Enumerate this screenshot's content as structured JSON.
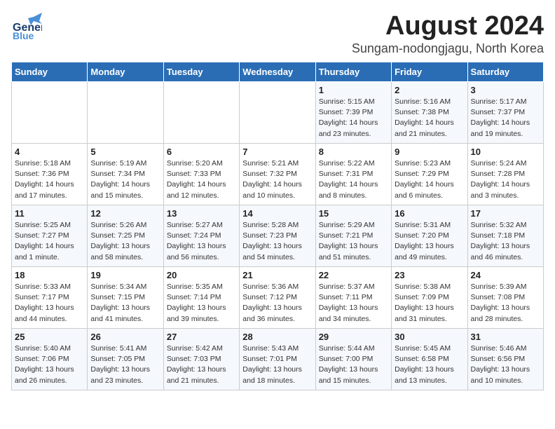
{
  "logo": {
    "text_general": "General",
    "text_blue": "Blue"
  },
  "title": "August 2024",
  "subtitle": "Sungam-nodongjagu, North Korea",
  "days_header": [
    "Sunday",
    "Monday",
    "Tuesday",
    "Wednesday",
    "Thursday",
    "Friday",
    "Saturday"
  ],
  "weeks": [
    [
      {
        "day": "",
        "info": ""
      },
      {
        "day": "",
        "info": ""
      },
      {
        "day": "",
        "info": ""
      },
      {
        "day": "",
        "info": ""
      },
      {
        "day": "1",
        "info": "Sunrise: 5:15 AM\nSunset: 7:39 PM\nDaylight: 14 hours\nand 23 minutes."
      },
      {
        "day": "2",
        "info": "Sunrise: 5:16 AM\nSunset: 7:38 PM\nDaylight: 14 hours\nand 21 minutes."
      },
      {
        "day": "3",
        "info": "Sunrise: 5:17 AM\nSunset: 7:37 PM\nDaylight: 14 hours\nand 19 minutes."
      }
    ],
    [
      {
        "day": "4",
        "info": "Sunrise: 5:18 AM\nSunset: 7:36 PM\nDaylight: 14 hours\nand 17 minutes."
      },
      {
        "day": "5",
        "info": "Sunrise: 5:19 AM\nSunset: 7:34 PM\nDaylight: 14 hours\nand 15 minutes."
      },
      {
        "day": "6",
        "info": "Sunrise: 5:20 AM\nSunset: 7:33 PM\nDaylight: 14 hours\nand 12 minutes."
      },
      {
        "day": "7",
        "info": "Sunrise: 5:21 AM\nSunset: 7:32 PM\nDaylight: 14 hours\nand 10 minutes."
      },
      {
        "day": "8",
        "info": "Sunrise: 5:22 AM\nSunset: 7:31 PM\nDaylight: 14 hours\nand 8 minutes."
      },
      {
        "day": "9",
        "info": "Sunrise: 5:23 AM\nSunset: 7:29 PM\nDaylight: 14 hours\nand 6 minutes."
      },
      {
        "day": "10",
        "info": "Sunrise: 5:24 AM\nSunset: 7:28 PM\nDaylight: 14 hours\nand 3 minutes."
      }
    ],
    [
      {
        "day": "11",
        "info": "Sunrise: 5:25 AM\nSunset: 7:27 PM\nDaylight: 14 hours\nand 1 minute."
      },
      {
        "day": "12",
        "info": "Sunrise: 5:26 AM\nSunset: 7:25 PM\nDaylight: 13 hours\nand 58 minutes."
      },
      {
        "day": "13",
        "info": "Sunrise: 5:27 AM\nSunset: 7:24 PM\nDaylight: 13 hours\nand 56 minutes."
      },
      {
        "day": "14",
        "info": "Sunrise: 5:28 AM\nSunset: 7:23 PM\nDaylight: 13 hours\nand 54 minutes."
      },
      {
        "day": "15",
        "info": "Sunrise: 5:29 AM\nSunset: 7:21 PM\nDaylight: 13 hours\nand 51 minutes."
      },
      {
        "day": "16",
        "info": "Sunrise: 5:31 AM\nSunset: 7:20 PM\nDaylight: 13 hours\nand 49 minutes."
      },
      {
        "day": "17",
        "info": "Sunrise: 5:32 AM\nSunset: 7:18 PM\nDaylight: 13 hours\nand 46 minutes."
      }
    ],
    [
      {
        "day": "18",
        "info": "Sunrise: 5:33 AM\nSunset: 7:17 PM\nDaylight: 13 hours\nand 44 minutes."
      },
      {
        "day": "19",
        "info": "Sunrise: 5:34 AM\nSunset: 7:15 PM\nDaylight: 13 hours\nand 41 minutes."
      },
      {
        "day": "20",
        "info": "Sunrise: 5:35 AM\nSunset: 7:14 PM\nDaylight: 13 hours\nand 39 minutes."
      },
      {
        "day": "21",
        "info": "Sunrise: 5:36 AM\nSunset: 7:12 PM\nDaylight: 13 hours\nand 36 minutes."
      },
      {
        "day": "22",
        "info": "Sunrise: 5:37 AM\nSunset: 7:11 PM\nDaylight: 13 hours\nand 34 minutes."
      },
      {
        "day": "23",
        "info": "Sunrise: 5:38 AM\nSunset: 7:09 PM\nDaylight: 13 hours\nand 31 minutes."
      },
      {
        "day": "24",
        "info": "Sunrise: 5:39 AM\nSunset: 7:08 PM\nDaylight: 13 hours\nand 28 minutes."
      }
    ],
    [
      {
        "day": "25",
        "info": "Sunrise: 5:40 AM\nSunset: 7:06 PM\nDaylight: 13 hours\nand 26 minutes."
      },
      {
        "day": "26",
        "info": "Sunrise: 5:41 AM\nSunset: 7:05 PM\nDaylight: 13 hours\nand 23 minutes."
      },
      {
        "day": "27",
        "info": "Sunrise: 5:42 AM\nSunset: 7:03 PM\nDaylight: 13 hours\nand 21 minutes."
      },
      {
        "day": "28",
        "info": "Sunrise: 5:43 AM\nSunset: 7:01 PM\nDaylight: 13 hours\nand 18 minutes."
      },
      {
        "day": "29",
        "info": "Sunrise: 5:44 AM\nSunset: 7:00 PM\nDaylight: 13 hours\nand 15 minutes."
      },
      {
        "day": "30",
        "info": "Sunrise: 5:45 AM\nSunset: 6:58 PM\nDaylight: 13 hours\nand 13 minutes."
      },
      {
        "day": "31",
        "info": "Sunrise: 5:46 AM\nSunset: 6:56 PM\nDaylight: 13 hours\nand 10 minutes."
      }
    ]
  ]
}
